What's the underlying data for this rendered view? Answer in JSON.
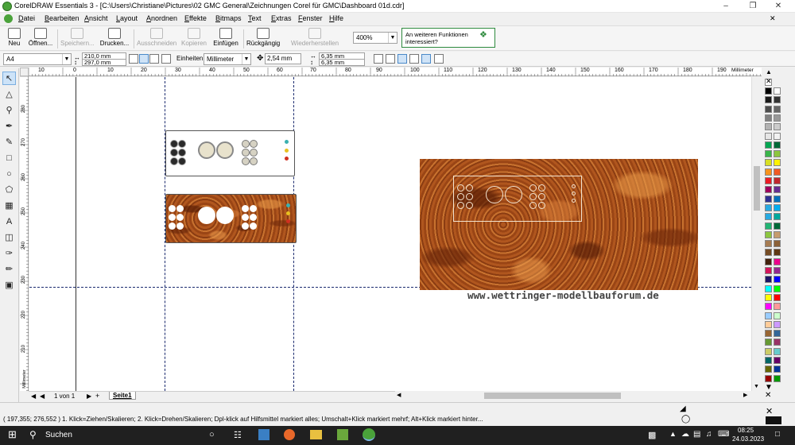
{
  "window": {
    "title": "CorelDRAW Essentials 3 - [C:\\Users\\Christiane\\Pictures\\02 GMC General\\Zeichnungen Corel für GMC\\Dashboard 01d.cdr]"
  },
  "menu": [
    "Datei",
    "Bearbeiten",
    "Ansicht",
    "Layout",
    "Anordnen",
    "Effekte",
    "Bitmaps",
    "Text",
    "Extras",
    "Fenster",
    "Hilfe"
  ],
  "toolbar": {
    "buttons": [
      {
        "label": "Neu",
        "enabled": true,
        "icon": "new-doc-icon"
      },
      {
        "label": "Öffnen...",
        "enabled": true,
        "icon": "open-icon"
      },
      {
        "label": "Speichern...",
        "enabled": false,
        "icon": "save-icon"
      },
      {
        "label": "Drucken...",
        "enabled": true,
        "icon": "print-icon"
      },
      {
        "label": "Ausschneiden",
        "enabled": false,
        "icon": "scissors-icon"
      },
      {
        "label": "Kopieren",
        "enabled": false,
        "icon": "copy-icon"
      },
      {
        "label": "Einfügen",
        "enabled": true,
        "icon": "paste-icon"
      },
      {
        "label": "Rückgängig",
        "enabled": true,
        "icon": "undo-icon"
      },
      {
        "label": "Wiederherstellen",
        "enabled": false,
        "icon": "redo-icon"
      }
    ],
    "zoom": "400%",
    "info_text": "An weiteren Funktionen interessiert?"
  },
  "propbar": {
    "paper": "A4",
    "width": "210,0 mm",
    "height": "297,0 mm",
    "units_label": "Einheiten:",
    "units": "Millimeter",
    "nudge": "2,54 mm",
    "dup_x": "6,35 mm",
    "dup_y": "6,35 mm"
  },
  "ruler": {
    "h_ticks": [
      "10",
      "0",
      "10",
      "20",
      "30",
      "40",
      "50",
      "60",
      "70",
      "80",
      "90",
      "100",
      "110",
      "120",
      "130",
      "140",
      "150",
      "160",
      "170",
      "180",
      "190"
    ],
    "h_unit": "Millimeter",
    "v_ticks": [
      "280",
      "270",
      "260",
      "250",
      "240",
      "230",
      "220",
      "210"
    ],
    "v_unit": "Millimeter"
  },
  "canvas": {
    "watermark": "www.wettringer-modellbauforum.de"
  },
  "pages": {
    "count": "1 von 1",
    "tab": "Seite1"
  },
  "status": {
    "coords": "( 197,355; 276,552 )",
    "hint": "1. Klick=Ziehen/Skalieren; 2. Klick=Drehen/Skalieren; Dpl-klick auf Hilfsmittel markiert alles; Umschalt+Klick markiert mehrf; Alt+Klick markiert hinter..."
  },
  "taskbar": {
    "search": "Suchen",
    "time": "08:25",
    "date": "24.03.2023"
  },
  "palette_colors": [
    "#000000",
    "#ffffff",
    "#1a1a1a",
    "#333333",
    "#4d4d4d",
    "#666666",
    "#808080",
    "#999999",
    "#b3b3b3",
    "#cccccc",
    "#e6e6e6",
    "#f2f2f2",
    "#00a651",
    "#006837",
    "#39b54a",
    "#8dc63f",
    "#d7df23",
    "#fff200",
    "#f7941d",
    "#f15a24",
    "#ed1c24",
    "#c1272d",
    "#9e005d",
    "#662d91",
    "#2e3192",
    "#0071bc",
    "#29abe2",
    "#00aeef",
    "#27aae1",
    "#00a99d",
    "#22b573",
    "#006837",
    "#8cc63f",
    "#c69c6d",
    "#a67c52",
    "#8c6239",
    "#754c24",
    "#603813",
    "#42210b",
    "#ec008c",
    "#d4145a",
    "#93278f",
    "#1b1464",
    "#0000ff",
    "#00ffff",
    "#00ff00",
    "#ffff00",
    "#ff0000",
    "#ff00ff",
    "#ff9999",
    "#99ccff",
    "#ccffcc",
    "#ffcc99",
    "#cc99ff",
    "#996633",
    "#336699",
    "#669933",
    "#993366",
    "#cccc66",
    "#66cccc",
    "#006666",
    "#660066",
    "#666600",
    "#003399",
    "#990000",
    "#009900"
  ]
}
